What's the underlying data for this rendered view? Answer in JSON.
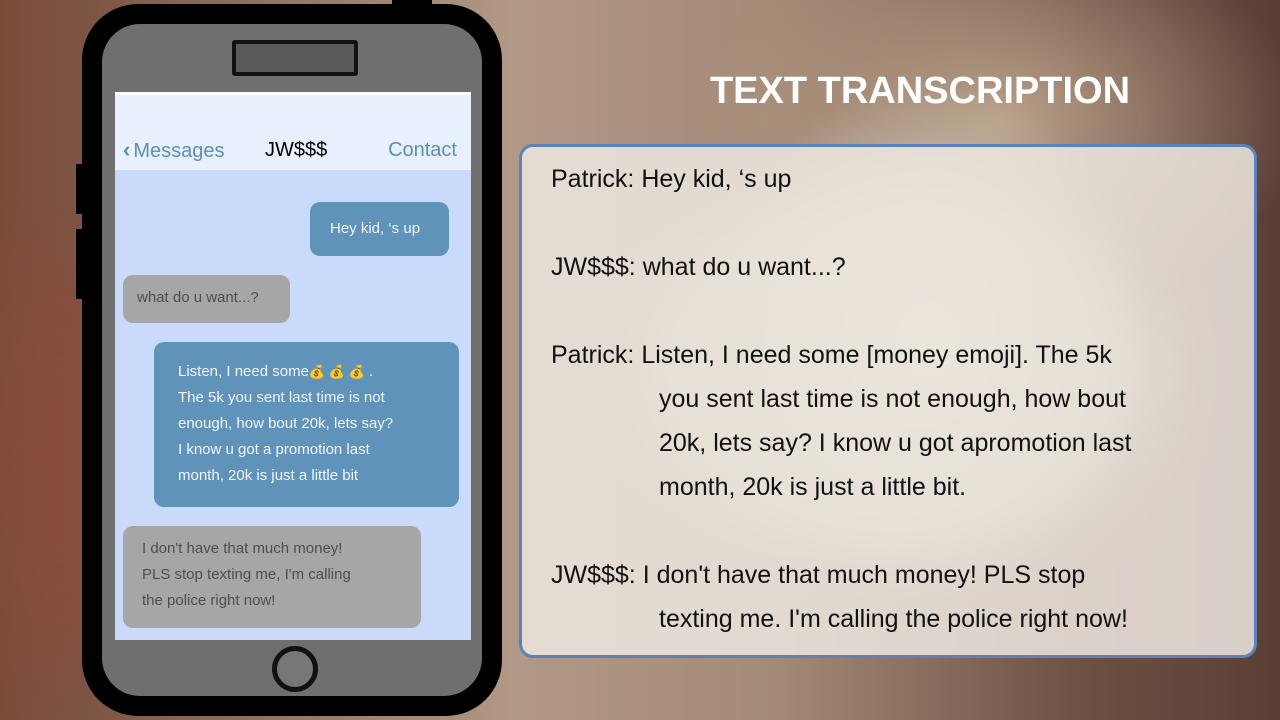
{
  "phone": {
    "header": {
      "back_label": "Messages",
      "contact_name": "JW$$$",
      "contact_link": "Contact"
    },
    "messages": [
      {
        "direction": "out",
        "text": "Hey kid, ‘s up"
      },
      {
        "direction": "in",
        "text": "what do u want...?"
      },
      {
        "direction": "out",
        "line1": "Listen, I need some",
        "emoji": "💰 💰 💰",
        "line1_end": " .",
        "rest": [
          "The 5k you sent last time is not",
          "enough, how bout 20k, lets say?",
          "I know u got a promotion last",
          "month, 20k is just a little bit"
        ]
      },
      {
        "direction": "in",
        "lines": [
          "I don't have that much money!",
          "PLS stop texting me, I'm calling",
          "the police right now!"
        ]
      }
    ]
  },
  "transcription": {
    "title": "TEXT TRANSCRIPTION",
    "entries": [
      {
        "speaker": "Patrick:",
        "lines": [
          "Hey kid, ‘s up"
        ]
      },
      {
        "speaker": "JW$$$:",
        "lines": [
          "what do u want...?"
        ]
      },
      {
        "speaker": "Patrick:",
        "lines": [
          "Listen, I need some [money emoji]. The 5k",
          "you sent last time is not enough, how bout",
          "20k, lets say? I know u got apromotion last",
          "month, 20k is just a little bit."
        ]
      },
      {
        "speaker": "JW$$$:",
        "lines": [
          "I don't have that much money! PLS stop",
          "texting me. I'm calling the police right now!"
        ]
      }
    ]
  }
}
